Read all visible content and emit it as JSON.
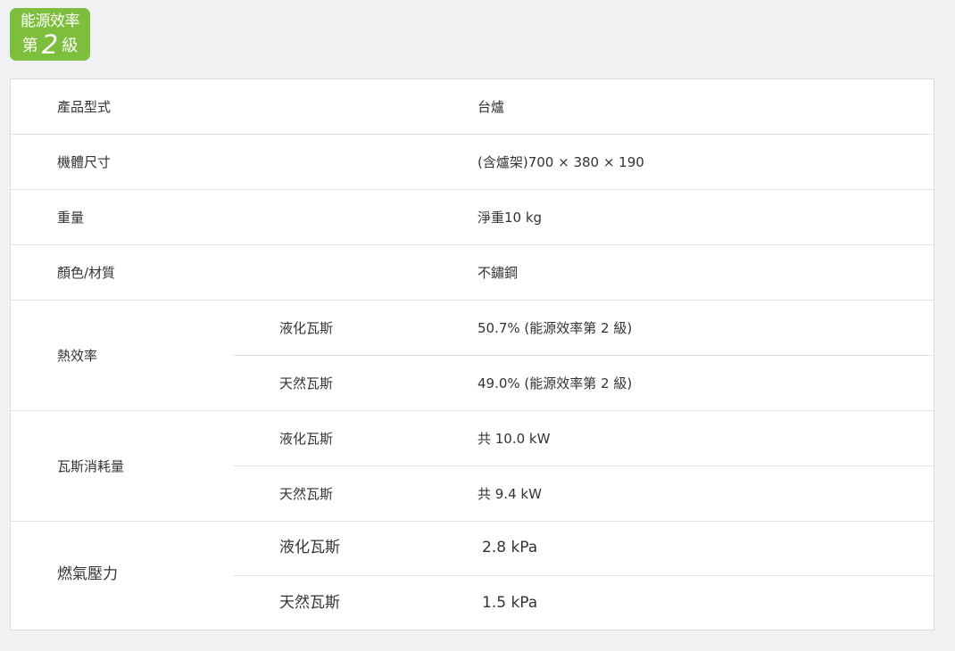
{
  "badge": {
    "title": "能源效率",
    "grade_prefix": "第",
    "grade_number": "2",
    "grade_suffix": "級",
    "color": "#7dbe3c"
  },
  "rows": {
    "model_type": {
      "label": "產品型式",
      "value": "台爐"
    },
    "dimensions": {
      "label": "機體尺寸",
      "value": "(含爐架)700 × 380 × 190"
    },
    "weight": {
      "label": "重量",
      "value": "淨重10 kg"
    },
    "color_material": {
      "label": "顏色/材質",
      "value": "不鏽鋼"
    },
    "thermal_efficiency": {
      "label": "熱效率",
      "lpg": {
        "sub": "液化瓦斯",
        "value": "50.7%  (能源效率第 2 級)"
      },
      "ng": {
        "sub": "天然瓦斯",
        "value": "49.0%  (能源效率第 2 級)"
      }
    },
    "gas_consumption": {
      "label": "瓦斯消耗量",
      "lpg": {
        "sub": "液化瓦斯",
        "value": "共 10.0 kW"
      },
      "ng": {
        "sub": "天然瓦斯",
        "value": "共 9.4 kW"
      }
    },
    "gas_pressure": {
      "label": "燃氣壓力",
      "lpg": {
        "sub": "液化瓦斯",
        "value": "2.8 kPa"
      },
      "ng": {
        "sub": "天然瓦斯",
        "value": "1.5 kPa"
      }
    }
  }
}
